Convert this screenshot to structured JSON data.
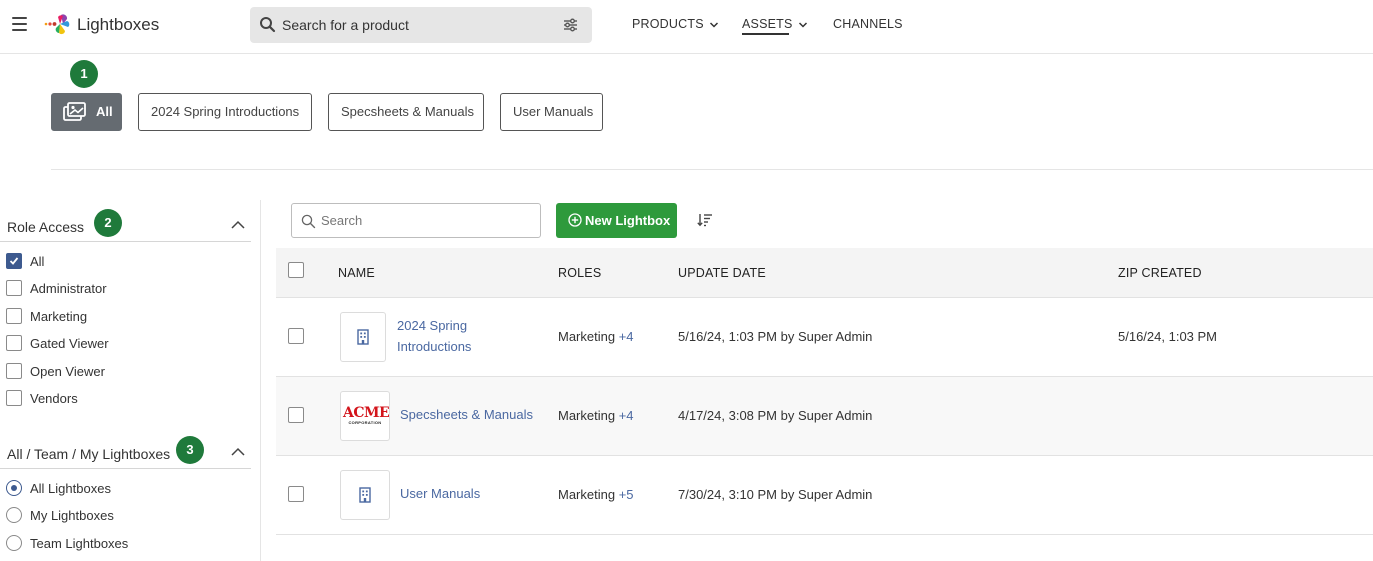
{
  "header": {
    "brand": "Lightboxes",
    "search_placeholder": "Search for a product",
    "nav": [
      {
        "label": "PRODUCTS",
        "has_dropdown": true
      },
      {
        "label": "ASSETS",
        "has_dropdown": true,
        "active": true
      },
      {
        "label": "CHANNELS",
        "has_dropdown": false
      }
    ]
  },
  "badges": [
    "1",
    "2",
    "3"
  ],
  "categories": [
    {
      "label": "All",
      "active": true
    },
    {
      "label": "2024 Spring Introductions"
    },
    {
      "label": "Specsheets & Manuals"
    },
    {
      "label": "User Manuals"
    }
  ],
  "sidebar": {
    "role_access": {
      "title": "Role Access",
      "options": [
        {
          "label": "All",
          "checked": true
        },
        {
          "label": "Administrator",
          "checked": false
        },
        {
          "label": "Marketing",
          "checked": false
        },
        {
          "label": "Gated Viewer",
          "checked": false
        },
        {
          "label": "Open Viewer",
          "checked": false
        },
        {
          "label": "Vendors",
          "checked": false
        }
      ]
    },
    "scope": {
      "title": "All / Team / My Lightboxes",
      "options": [
        {
          "label": "All Lightboxes",
          "selected": true
        },
        {
          "label": "My Lightboxes",
          "selected": false
        },
        {
          "label": "Team Lightboxes",
          "selected": false
        }
      ]
    }
  },
  "toolbar": {
    "search_placeholder": "Search",
    "new_button": "New Lightbox"
  },
  "table": {
    "columns": [
      "NAME",
      "ROLES",
      "UPDATE DATE",
      "ZIP CREATED"
    ],
    "rows": [
      {
        "name_line1": "2024 Spring",
        "name_line2": "Introductions",
        "role": "Marketing",
        "role_more": "+4",
        "updated": "5/16/24, 1:03 PM by Super Admin",
        "zip": "5/16/24, 1:03 PM",
        "thumb": "building-icon"
      },
      {
        "name": "Specsheets & Manuals",
        "role": "Marketing",
        "role_more": "+4",
        "updated": "4/17/24, 3:08 PM by Super Admin",
        "zip": "",
        "thumb": "acme-logo",
        "thumb_text": "ACME",
        "thumb_subtext": "CORPORATION"
      },
      {
        "name": "User Manuals",
        "role": "Marketing",
        "role_more": "+5",
        "updated": "7/30/24, 3:10 PM by Super Admin",
        "zip": "",
        "thumb": "building-icon"
      }
    ]
  },
  "colors": {
    "badge": "#1f7a3b",
    "new_button": "#2e9a3c",
    "link": "#4a68a1",
    "checkbox_active": "#3d5a8f",
    "chip_active": "#656b71"
  }
}
